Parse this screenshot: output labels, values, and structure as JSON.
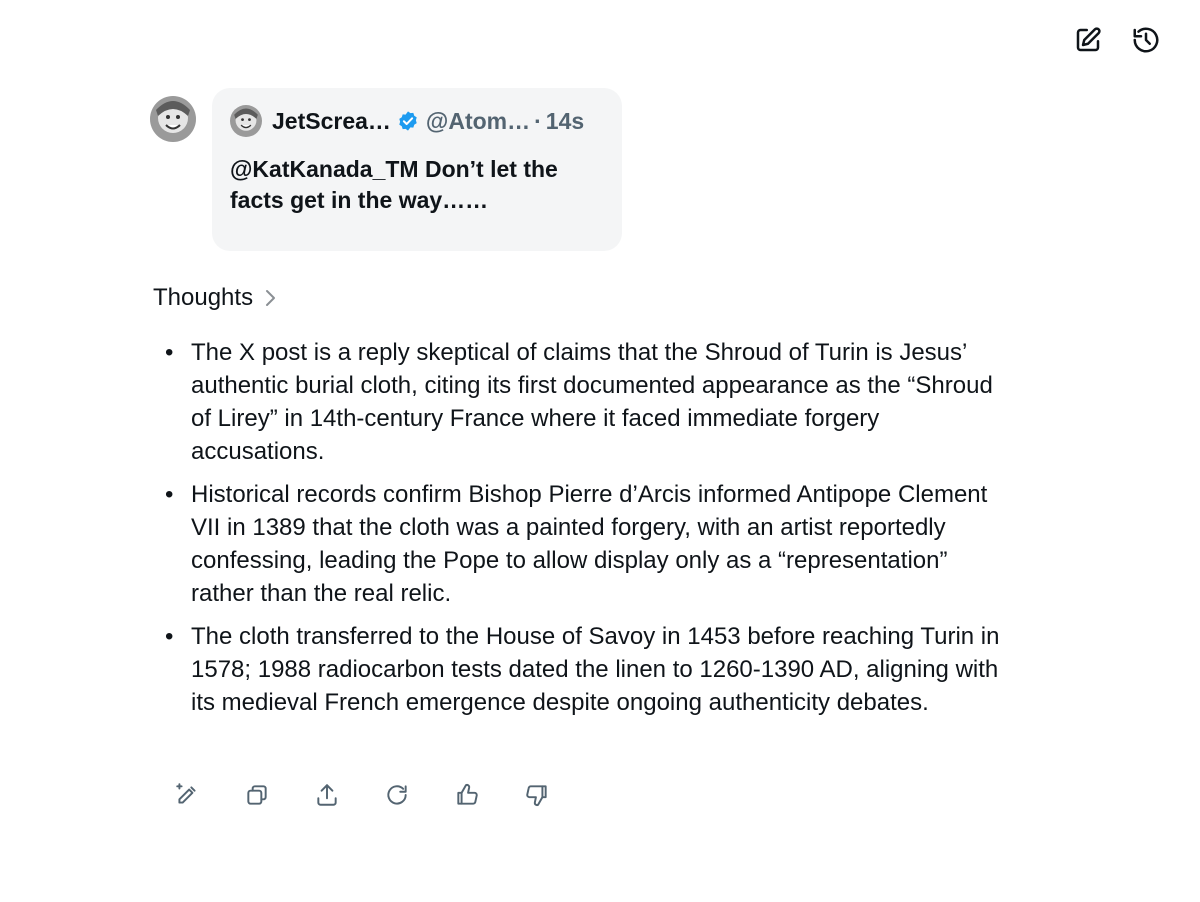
{
  "toolbar": {
    "icons": [
      "edit-icon",
      "history-icon"
    ]
  },
  "quote": {
    "author_name": "JetScrea…",
    "handle": "@Atom…",
    "separator": "·",
    "time": "14s",
    "text": "@KatKanada_TM Don’t let the facts get in the way……",
    "verified_color": "#1d9bf0"
  },
  "thoughts": {
    "label": "Thoughts"
  },
  "response": {
    "bullets": [
      "The X post is a reply skeptical of claims that the Shroud of Turin is Jesus’ authentic burial cloth, citing its first documented appearance as the “Shroud of Lirey” in 14th-century France where it faced immediate forgery accusations.",
      "Historical records confirm Bishop Pierre d’Arcis informed Antipope Clement VII in 1389 that the cloth was a painted forgery, with an artist reportedly confessing, leading the Pope to allow display only as a “representation” rather than the real relic.",
      "The cloth transferred to the House of Savoy in 1453 before reaching Turin in 1578; 1988 radiocarbon tests dated the linen to 1260-1390 AD, aligning with its medieval French emergence despite ongoing authenticity debates."
    ]
  },
  "actions": {
    "icons": [
      "pencil-sparkle-icon",
      "copy-icon",
      "share-icon",
      "regenerate-icon",
      "thumbs-up-icon",
      "thumbs-down-icon"
    ]
  }
}
